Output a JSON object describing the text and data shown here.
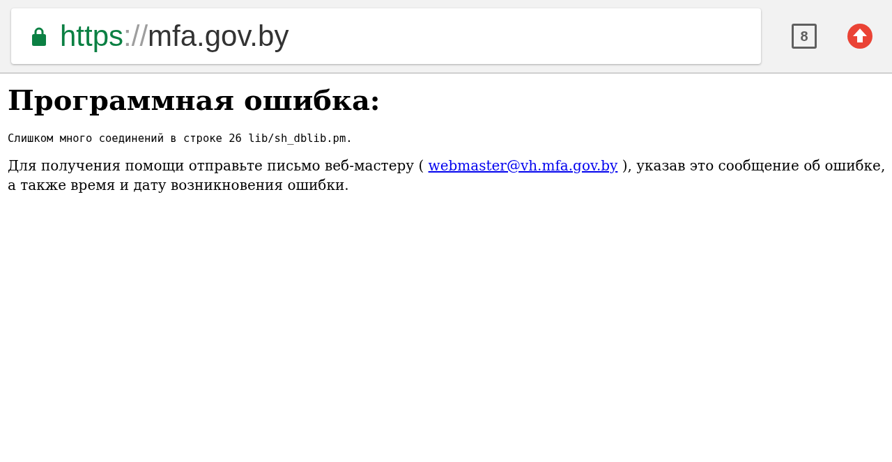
{
  "address_bar": {
    "secure": true,
    "scheme": "https",
    "separator": "://",
    "host": "mfa.gov.by"
  },
  "tab_count": "8",
  "page": {
    "heading": "Программная ошибка:",
    "error_line": "Слишком много соединений в строке 26 lib/sh_dblib.pm.",
    "help": {
      "before": "Для получения помощи отправьте письмо веб-мастеру ( ",
      "link": "webmaster@vh.mfa.gov.by",
      "after": " ), указав это сообщение об ошибке, а также время и дату возникновения ошибки."
    }
  }
}
